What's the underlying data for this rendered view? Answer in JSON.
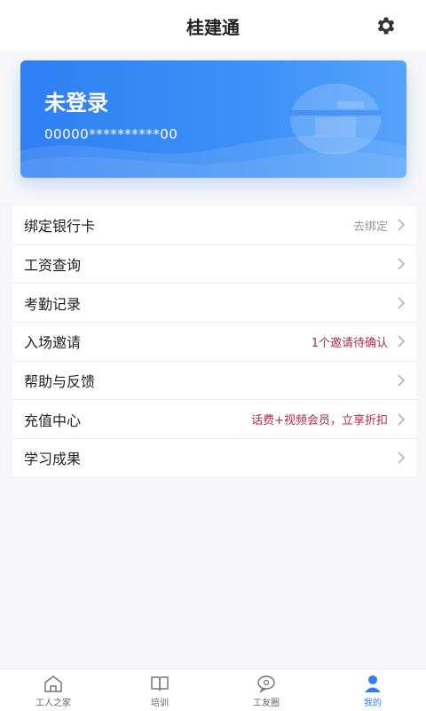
{
  "header": {
    "title": "桂建通"
  },
  "card": {
    "title": "未登录",
    "number": "00000**********00"
  },
  "menu": [
    {
      "label": "绑定银行卡",
      "hint": "去绑定",
      "hint_tone": "gray"
    },
    {
      "label": "工资查询",
      "hint": ""
    },
    {
      "label": "考勤记录",
      "hint": ""
    },
    {
      "label": "入场邀请",
      "hint": "1个邀请待确认",
      "hint_tone": "red"
    },
    {
      "label": "帮助与反馈",
      "hint": ""
    },
    {
      "label": "充值中心",
      "hint": "话费+视频会员，立享折扣",
      "hint_tone": "red"
    },
    {
      "label": "学习成果",
      "hint": ""
    }
  ],
  "tabs": [
    {
      "label": "工人之家",
      "icon": "home-icon"
    },
    {
      "label": "培训",
      "icon": "book-icon"
    },
    {
      "label": "工友圈",
      "icon": "chat-icon"
    },
    {
      "label": "我的",
      "icon": "user-icon",
      "active": true
    }
  ],
  "colors": {
    "accent": "#2f7ff3",
    "hint_red": "#b02b49",
    "hint_gray": "#999999"
  }
}
